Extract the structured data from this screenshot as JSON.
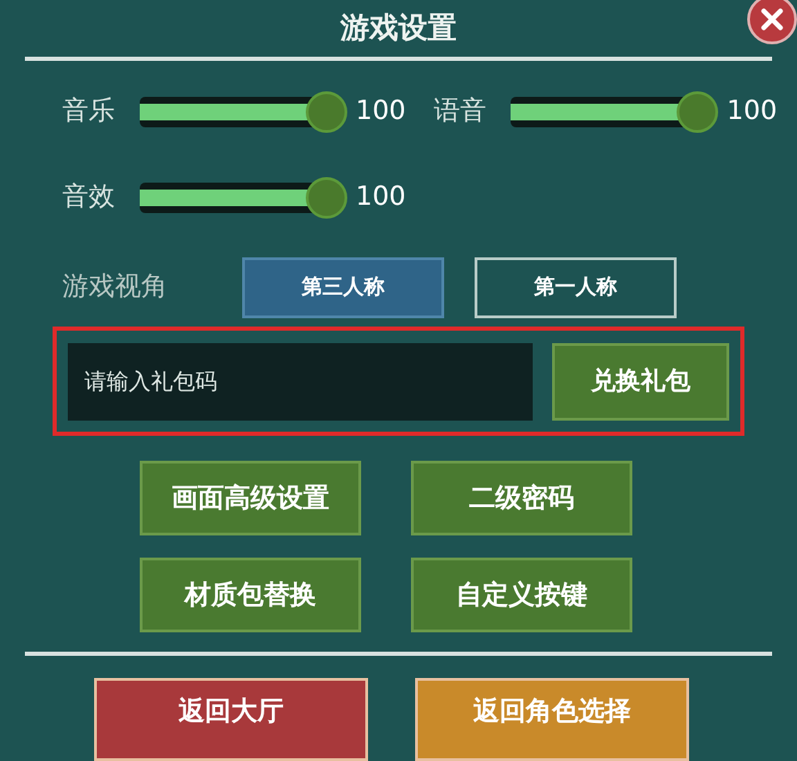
{
  "title": "游戏设置",
  "sliders": [
    {
      "label": "音乐",
      "level": 1,
      "reading": "100"
    },
    {
      "label": "语音",
      "level": 1,
      "reading": "100"
    },
    {
      "label": "音效",
      "level": 1,
      "reading": "100"
    }
  ],
  "view": {
    "label": "游戏视角",
    "options": [
      {
        "label": "第三人称",
        "selected": true
      },
      {
        "label": "第一人称",
        "selected": false
      }
    ]
  },
  "redeem": {
    "placeholder": "请输入礼包码",
    "button": "兑换礼包"
  },
  "buttons": [
    "画面高级设置",
    "二级密码",
    "材质包替换",
    "自定义按键"
  ],
  "bottom_buttons": [
    {
      "label": "返回大厅",
      "color": "#a8393b"
    },
    {
      "label": "返回角色选择",
      "color": "#c98a2a"
    }
  ]
}
